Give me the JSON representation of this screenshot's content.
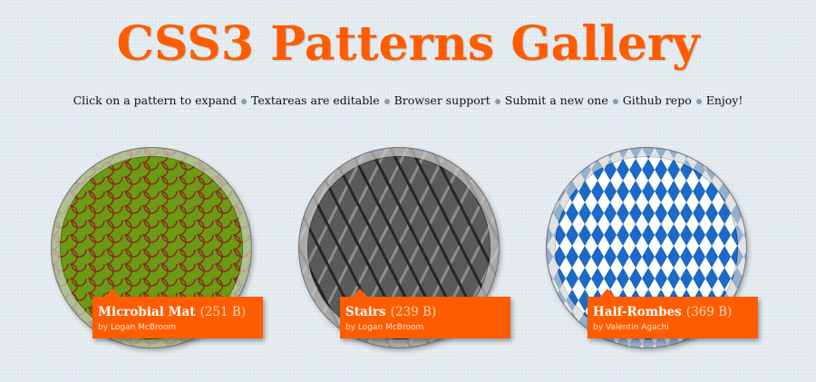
{
  "header": {
    "title": "CSS3 Patterns Gallery"
  },
  "nav": {
    "items": [
      "Click on a pattern to expand",
      "Textareas are editable",
      "Browser support",
      "Submit a new one",
      "Github repo",
      "Enjoy!"
    ]
  },
  "patterns": [
    {
      "name": "Microbial Mat",
      "size": "(251 B)",
      "author": "by Logan McBroom"
    },
    {
      "name": "Stairs",
      "size": "(239 B)",
      "author": "by Logan McBroom"
    },
    {
      "name": "Half-Rombes",
      "size": "(369 B)",
      "author": "by Valentin Agachi"
    }
  ],
  "colors": {
    "accent": "#ff5c00",
    "background": "#e2e9ee"
  }
}
